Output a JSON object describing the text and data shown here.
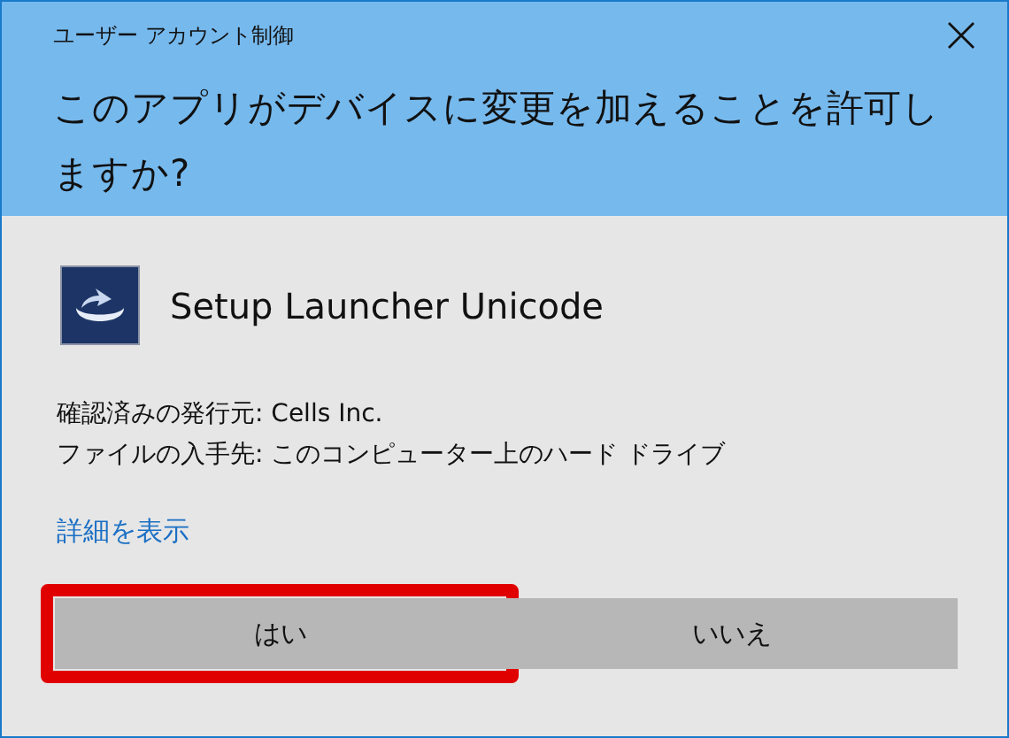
{
  "window": {
    "title": "ユーザー アカウント制御"
  },
  "question": "このアプリがデバイスに変更を加えることを許可しますか?",
  "app_name": "Setup Launcher Unicode",
  "details": [
    "確認済みの発行元: Cells Inc.",
    "ファイルの入手先: このコンピューター上のハード ドライブ"
  ],
  "details_link": "詳細を表示",
  "buttons": [
    {
      "label": "はい",
      "highlighted": true
    },
    {
      "label": "いいえ",
      "highlighted": false
    }
  ]
}
